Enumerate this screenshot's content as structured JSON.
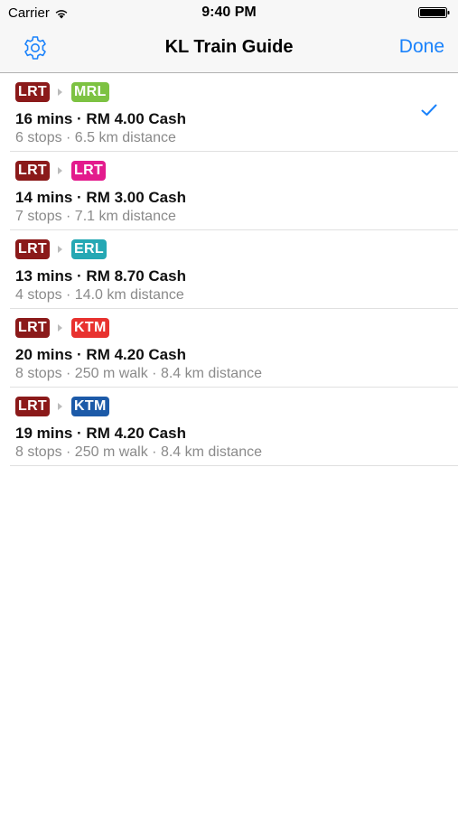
{
  "status_bar": {
    "carrier": "Carrier",
    "time": "9:40 PM"
  },
  "nav": {
    "title": "KL Train Guide",
    "done_label": "Done",
    "accent_color": "#1a82fb"
  },
  "routes": [
    {
      "from": {
        "label": "LRT",
        "color": "#8b1a1a"
      },
      "to": {
        "label": "MRL",
        "color": "#7dc242"
      },
      "summary": "16 mins · RM 4.00 Cash",
      "details": "6 stops · 6.5 km distance",
      "selected": true
    },
    {
      "from": {
        "label": "LRT",
        "color": "#8b1a1a"
      },
      "to": {
        "label": "LRT",
        "color": "#e31b8d"
      },
      "summary": "14 mins · RM 3.00 Cash",
      "details": "7 stops · 7.1 km distance",
      "selected": false
    },
    {
      "from": {
        "label": "LRT",
        "color": "#8b1a1a"
      },
      "to": {
        "label": "ERL",
        "color": "#25a8b4"
      },
      "summary": "13 mins · RM 8.70 Cash",
      "details": "4 stops · 14.0 km distance",
      "selected": false
    },
    {
      "from": {
        "label": "LRT",
        "color": "#8b1a1a"
      },
      "to": {
        "label": "KTM",
        "color": "#e8322f"
      },
      "summary": "20 mins · RM 4.20 Cash",
      "details": "8 stops · 250 m walk · 8.4 km distance",
      "selected": false
    },
    {
      "from": {
        "label": "LRT",
        "color": "#8b1a1a"
      },
      "to": {
        "label": "KTM",
        "color": "#1c5aa8"
      },
      "summary": "19 mins · RM 4.20 Cash",
      "details": "8 stops · 250 m walk · 8.4 km distance",
      "selected": false
    }
  ]
}
